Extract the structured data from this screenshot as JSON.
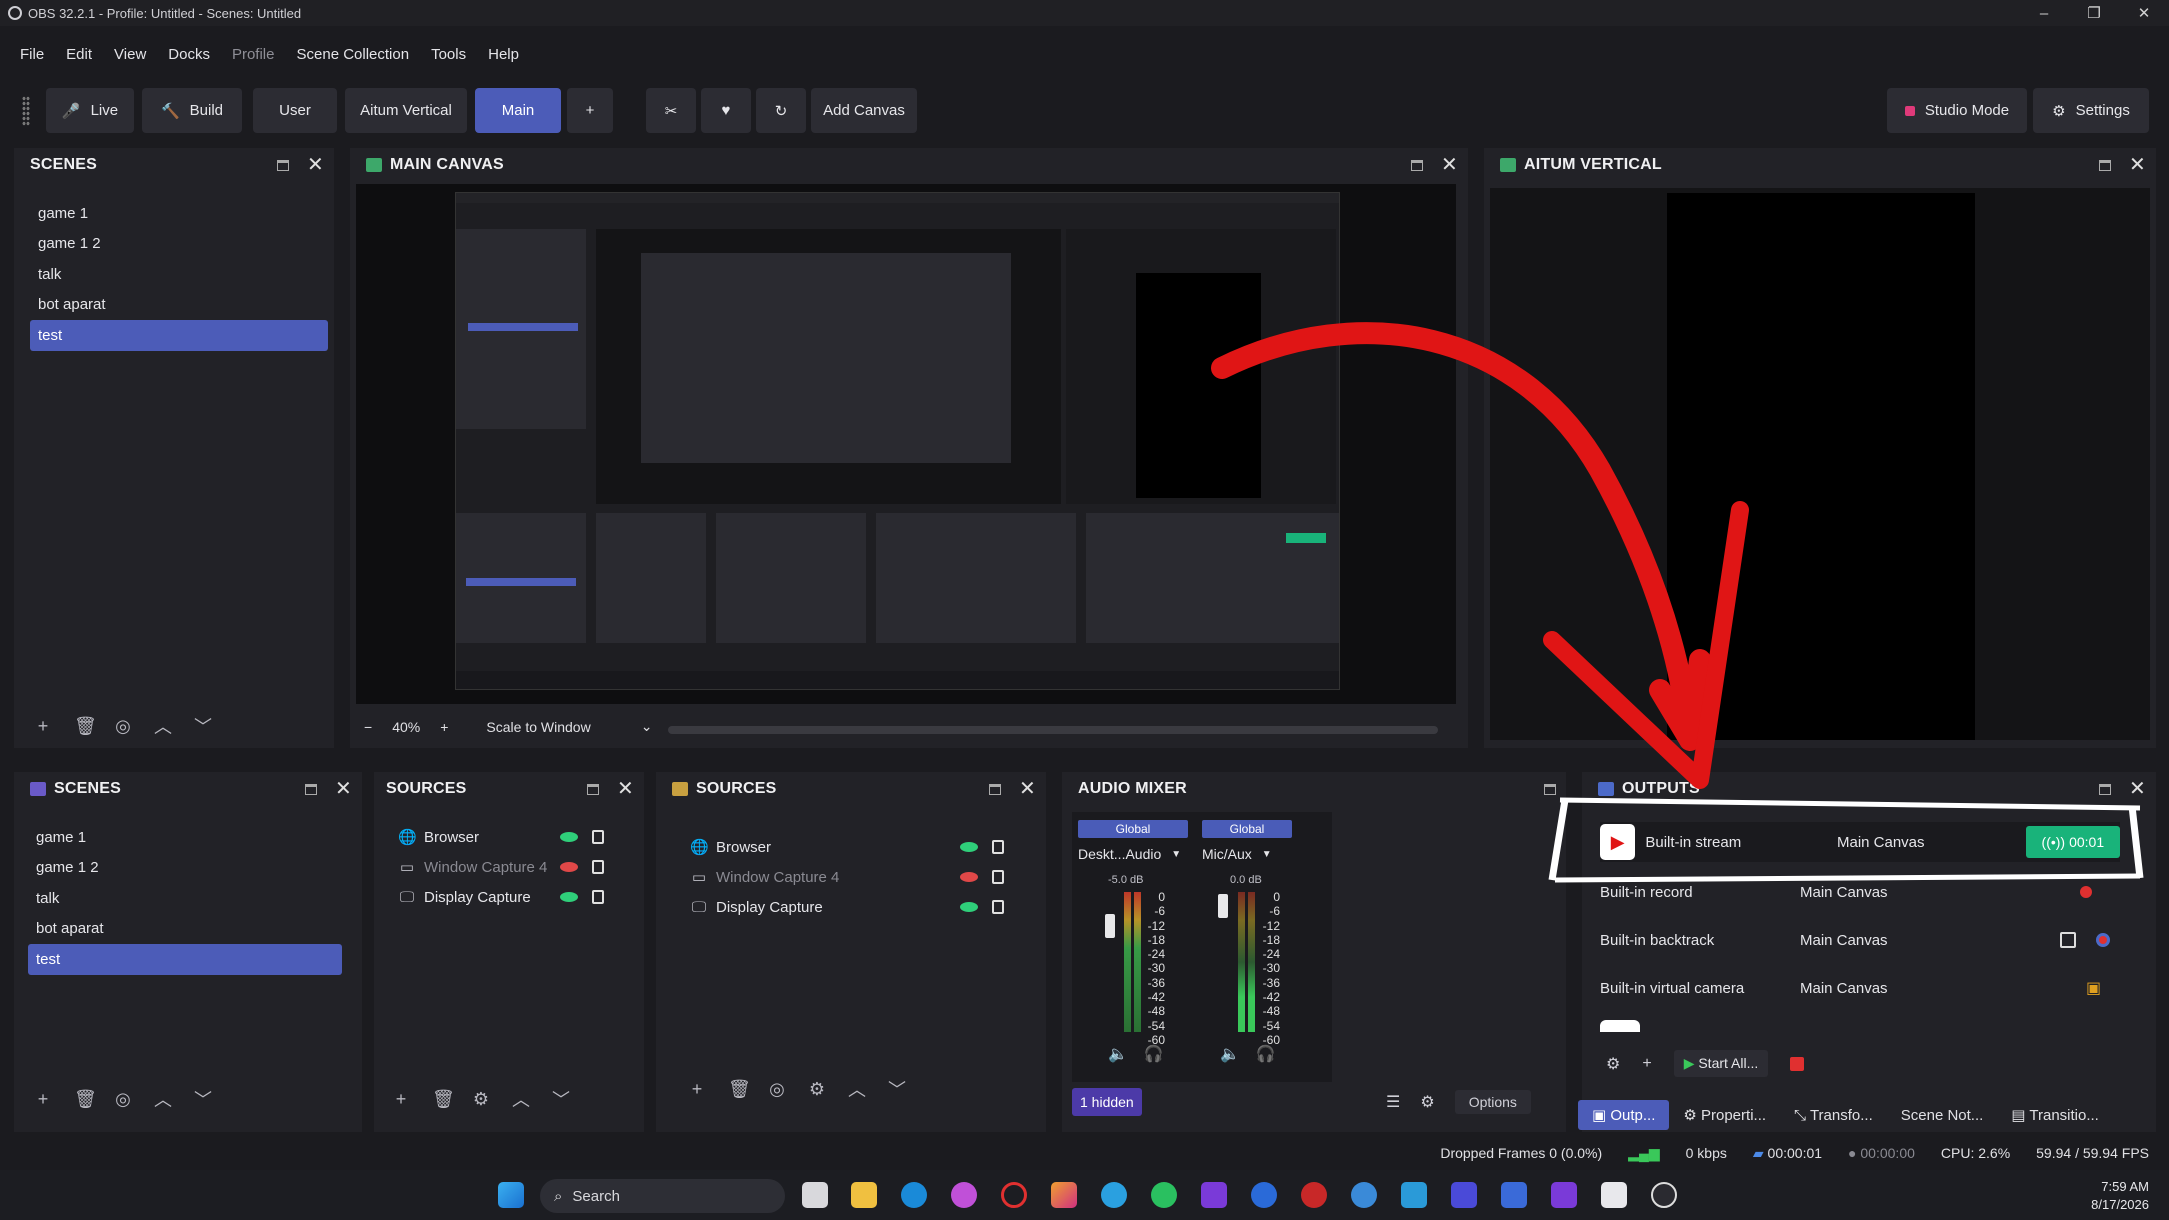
{
  "window": {
    "title": "OBS 32.2.1 - Profile: Untitled - Scenes: Untitled"
  },
  "menu": [
    "File",
    "Edit",
    "View",
    "Docks",
    "Profile",
    "Scene Collection",
    "Tools",
    "Help"
  ],
  "toolbar": {
    "live": "Live",
    "build": "Build",
    "user": "User",
    "aitum_vertical": "Aitum Vertical",
    "main": "Main",
    "plus": "+",
    "add_canvas": "Add Canvas",
    "studio_mode": "Studio Mode",
    "settings": "Settings"
  },
  "scenes_top": {
    "title": "SCENES",
    "items": [
      "game 1",
      "game 1 2",
      "talk",
      "bot aparat",
      "test"
    ],
    "selected": 4
  },
  "main_canvas": {
    "title": "MAIN CANVAS",
    "zoom": "40%",
    "scale_mode": "Scale to Window"
  },
  "aitum_vertical": {
    "title": "AITUM VERTICAL"
  },
  "scenes_bottom": {
    "title": "SCENES",
    "items": [
      "game 1",
      "game 1 2",
      "talk",
      "bot aparat",
      "test"
    ],
    "selected": 4
  },
  "sources_a": {
    "title": "SOURCES",
    "items": [
      "Browser",
      "Window Capture 4",
      "Display Capture"
    ]
  },
  "sources_b": {
    "title": "SOURCES",
    "items": [
      "Browser",
      "Window Capture 4",
      "Display Capture"
    ]
  },
  "audio_mixer": {
    "title": "AUDIO MIXER",
    "channels": [
      {
        "global": "Global",
        "name": "Deskt...Audio",
        "db": "-5.0 dB"
      },
      {
        "global": "Global",
        "name": "Mic/Aux",
        "db": "0.0 dB"
      }
    ],
    "scale": [
      "0",
      "-6",
      "-12",
      "-18",
      "-24",
      "-30",
      "-36",
      "-42",
      "-48",
      "-54",
      "-60"
    ],
    "hidden": "1 hidden",
    "options": "Options"
  },
  "outputs": {
    "title": "OUTPUTS",
    "rows": [
      {
        "name": "Built-in stream",
        "canvas": "Main Canvas",
        "status": "00:01"
      },
      {
        "name": "Built-in record",
        "canvas": "Main Canvas"
      },
      {
        "name": "Built-in backtrack",
        "canvas": "Main Canvas"
      },
      {
        "name": "Built-in virtual camera",
        "canvas": "Main Canvas"
      }
    ],
    "start_all": "Start All..."
  },
  "bottom_tabs": [
    "Outp...",
    "Properti...",
    "Transfo...",
    "Scene Not...",
    "Transitio..."
  ],
  "status": {
    "dropped": "Dropped Frames 0 (0.0%)",
    "kbps": "0 kbps",
    "stream_time": "00:00:01",
    "rec_time": "00:00:00",
    "cpu": "CPU: 2.6%",
    "fps": "59.94 / 59.94 FPS"
  },
  "taskbar": {
    "search": "Search",
    "time": "7:59 AM",
    "date": "8/17/2026"
  },
  "colors": {
    "accent": "#4c5cb8",
    "live_green": "#19b37a",
    "arrow_red": "#e01515"
  }
}
